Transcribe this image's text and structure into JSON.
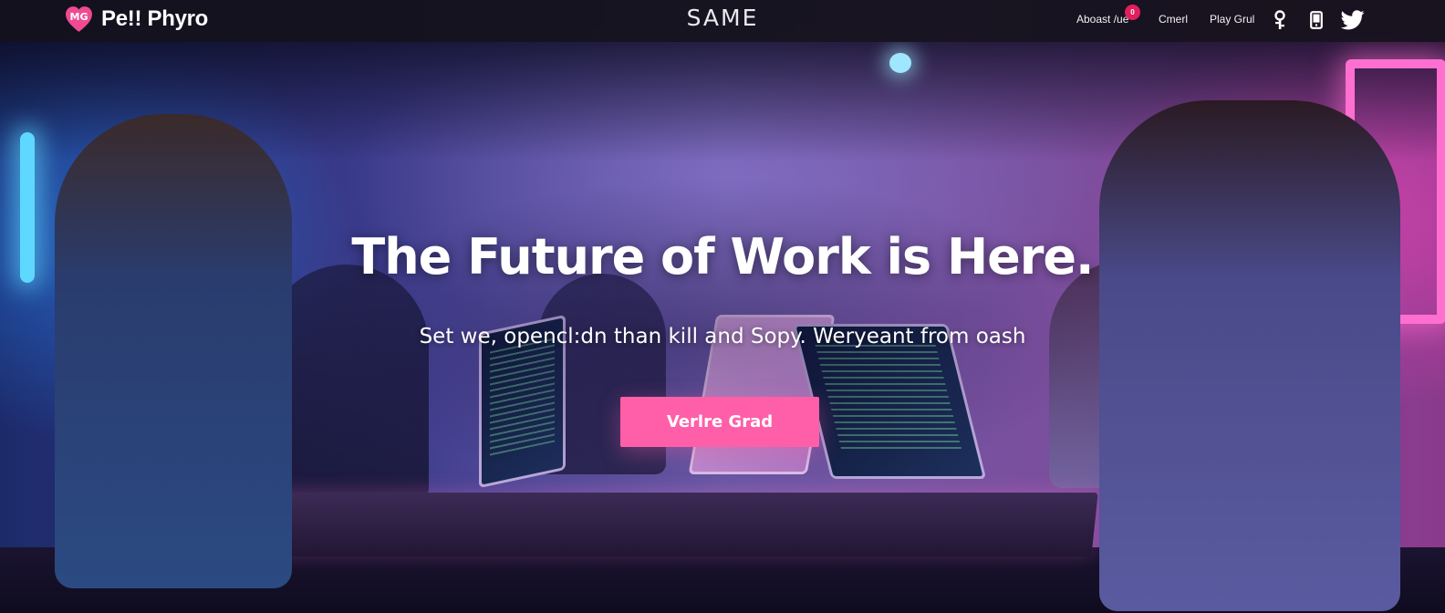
{
  "nav": {
    "brand_logo_text": "MG",
    "brand_name": "Pe!! Phyro",
    "center_title": "SAME",
    "links": {
      "about": "Aboast /ue",
      "about_badge": "0",
      "career": "Cmerl",
      "play": "Play Grul"
    },
    "icons": [
      "key-icon",
      "phone-icon",
      "twitter-icon"
    ]
  },
  "hero": {
    "headline": "The Future of Work is Here.",
    "subheadline": "Set we, opencl:dn than kill and Sopy. Weryeant from oash",
    "cta_label": "Verlre Grad"
  },
  "colors": {
    "accent_pink": "#ff5fa8",
    "badge_red": "#e21f5e",
    "nav_background": "#121018"
  }
}
